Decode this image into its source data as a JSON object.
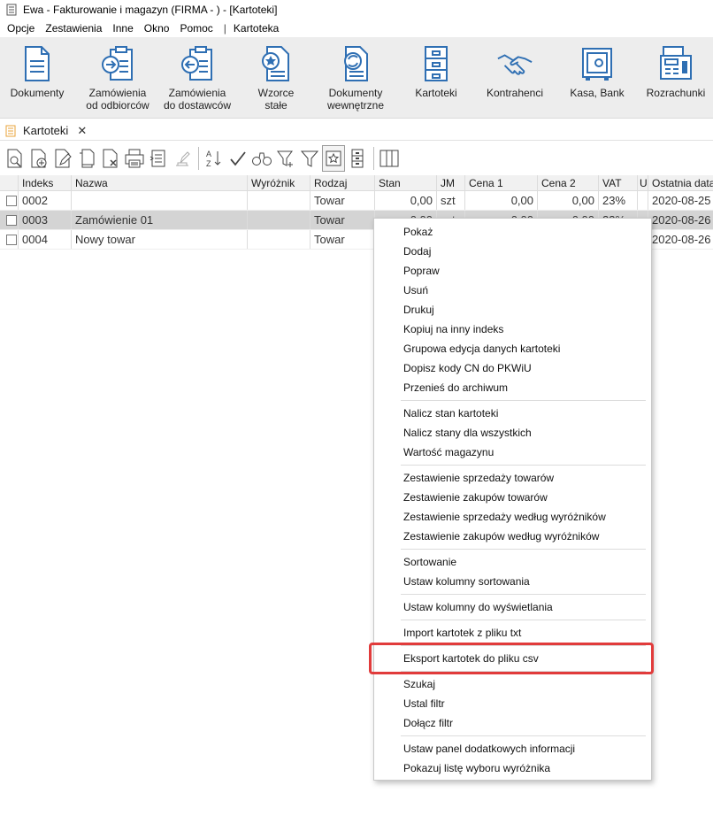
{
  "window": {
    "title": "Ewa - Fakturowanie i magazyn (FIRMA - ) - [Kartoteki]"
  },
  "menu": {
    "items": [
      "Opcje",
      "Zestawienia",
      "Inne",
      "Okno",
      "Pomoc"
    ],
    "separator": "|",
    "extra": "Kartoteka"
  },
  "ribbon": [
    {
      "line1": "Dokumenty",
      "line2": "",
      "icon": "document-icon"
    },
    {
      "line1": "Zamówienia",
      "line2": "od odbiorców",
      "icon": "order-in-icon"
    },
    {
      "line1": "Zamówienia",
      "line2": "do dostawców",
      "icon": "order-out-icon"
    },
    {
      "line1": "Wzorce",
      "line2": "stałe",
      "icon": "template-icon"
    },
    {
      "line1": "Dokumenty",
      "line2": "wewnętrzne",
      "icon": "internal-doc-icon"
    },
    {
      "line1": "Kartoteki",
      "line2": "",
      "icon": "cabinet-icon"
    },
    {
      "line1": "Kontrahenci",
      "line2": "",
      "icon": "handshake-icon"
    },
    {
      "line1": "Kasa, Bank",
      "line2": "",
      "icon": "safe-icon"
    },
    {
      "line1": "Rozrachunki",
      "line2": "",
      "icon": "register-icon"
    }
  ],
  "tab": {
    "label": "Kartoteki",
    "close": "✕"
  },
  "toolbar": {
    "icons": [
      "view-icon",
      "add-icon",
      "edit-icon",
      "copy-icon",
      "delete-icon",
      "print-icon",
      "list-icon",
      "stamp-icon",
      "sort-az-icon",
      "check-icon",
      "binoculars-icon",
      "filter-add-icon",
      "filter-icon",
      "star-icon",
      "cabinet-small-icon",
      "columns-icon"
    ]
  },
  "grid": {
    "columns": [
      "Indeks",
      "Nazwa",
      "Wyróżnik",
      "Rodzaj",
      "Stan",
      "JM",
      "Cena 1",
      "Cena 2",
      "VAT",
      "U",
      "Ostatnia data"
    ],
    "rows": [
      {
        "indeks": "0002",
        "nazwa": "",
        "wyroznik": "",
        "rodzaj": "Towar",
        "stan": "0,00",
        "jm": "szt",
        "cena1": "0,00",
        "cena2": "0,00",
        "vat": "23%",
        "u": "",
        "data": "2020-08-25",
        "selected": false
      },
      {
        "indeks": "0003",
        "nazwa": "Zamówienie 01",
        "wyroznik": "",
        "rodzaj": "Towar",
        "stan": "0,00",
        "jm": "szt",
        "cena1": "0,00",
        "cena2": "0,00",
        "vat": "23%",
        "u": "",
        "data": "2020-08-26",
        "selected": true
      },
      {
        "indeks": "0004",
        "nazwa": "Nowy towar",
        "wyroznik": "",
        "rodzaj": "Towar",
        "stan": "",
        "jm": "",
        "cena1": "",
        "cena2": "",
        "vat": "",
        "u": "",
        "data": "2020-08-26",
        "selected": false
      }
    ]
  },
  "context_menu": {
    "groups": [
      [
        "Pokaż",
        "Dodaj",
        "Popraw",
        "Usuń",
        "Drukuj",
        "Kopiuj na inny indeks",
        "Grupowa edycja danych kartoteki",
        "Dopisz kody CN do PKWiU",
        "Przenieś do archiwum"
      ],
      [
        "Nalicz stan kartoteki",
        "Nalicz stany dla wszystkich",
        "Wartość magazynu"
      ],
      [
        "Zestawienie sprzedaży towarów",
        "Zestawienie zakupów towarów",
        "Zestawienie sprzedaży według wyróżników",
        "Zestawienie zakupów według wyróżników"
      ],
      [
        "Sortowanie",
        "Ustaw kolumny sortowania"
      ],
      [
        "Ustaw kolumny do wyświetlania"
      ],
      [
        "Import kartotek z pliku txt"
      ],
      [
        "Eksport kartotek do pliku csv"
      ],
      [
        "Szukaj",
        "Ustal filtr",
        "Dołącz filtr"
      ],
      [
        "Ustaw panel dodatkowych informacji",
        "Pokazuj listę wyboru wyróżnika"
      ]
    ],
    "highlighted": "Eksport kartotek do pliku csv"
  },
  "colors": {
    "ribbon_bg": "#ededed",
    "icon_blue": "#2f6fb3",
    "selected_row": "#d4d4d4",
    "highlight": "#e13b3b",
    "tab_icon": "#e8a33a"
  }
}
